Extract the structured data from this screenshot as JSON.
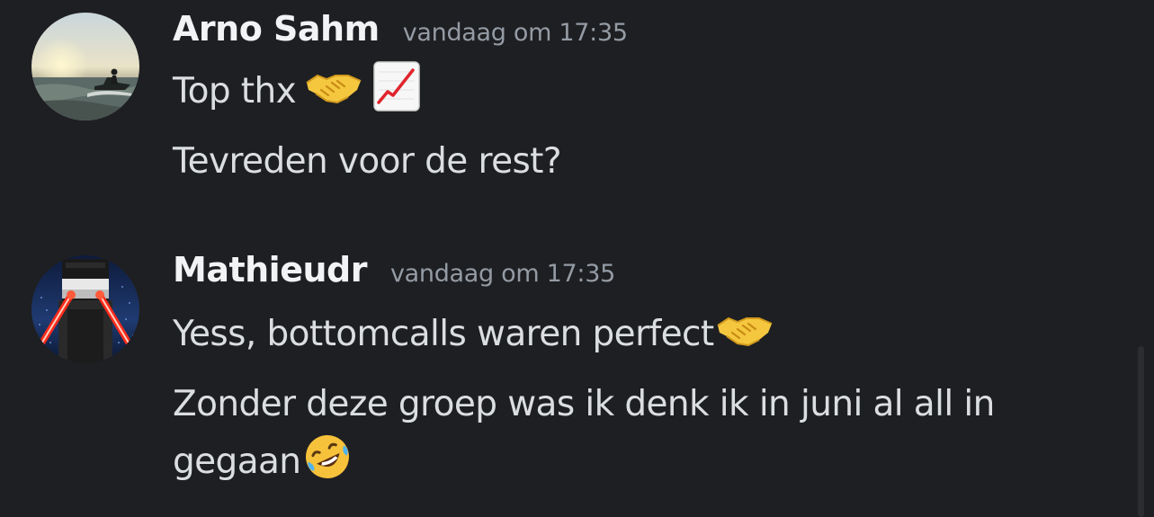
{
  "messages": [
    {
      "username": "Arno Sahm",
      "timestamp": "vandaag om 17:35",
      "avatar_icon": "jetski-sunset-avatar",
      "lines": [
        {
          "text": "Top thx",
          "emojis": [
            "handshake-emoji",
            "chart-increasing-emoji"
          ]
        },
        {
          "text": "Tevreden voor de rest?",
          "emojis": []
        }
      ]
    },
    {
      "username": "Mathieudr",
      "timestamp": "vandaag om 17:35",
      "avatar_icon": "laser-eyes-avatar",
      "lines": [
        {
          "text": "Yess, bottomcalls waren perfect",
          "emojis": [
            "handshake-emoji"
          ]
        },
        {
          "text": "Zonder deze groep was ik denk ik in juni al all in",
          "emojis": []
        },
        {
          "text": "gegaan",
          "emojis": [
            "rolling-on-floor-laughing-emoji"
          ]
        }
      ]
    }
  ],
  "colors": {
    "background": "#1e1f22",
    "username": "#f2f3f5",
    "timestamp": "#949ba4",
    "message_text": "#dbdee1"
  }
}
